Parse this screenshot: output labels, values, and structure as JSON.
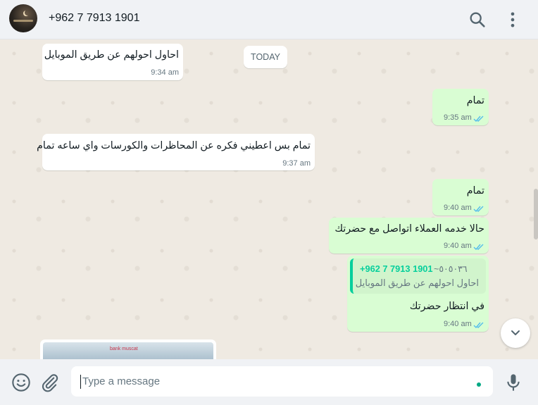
{
  "header": {
    "contact_name": "+962 7 7913 1901",
    "search_icon": "search-icon",
    "menu_icon": "kebab-menu-icon"
  },
  "chat": {
    "date_divider": "TODAY",
    "messages": [
      {
        "direction": "incoming",
        "text": "احاول احولهم عن طريق الموبايل",
        "time": "9:34 am"
      },
      {
        "direction": "outgoing",
        "text": "تمام",
        "time": "9:35 am",
        "status": "read"
      },
      {
        "direction": "incoming",
        "text": "تمام بس اعطيني فكره عن المحاظرات والكورسات واي ساعه تمام",
        "time": "9:37 am"
      },
      {
        "direction": "outgoing",
        "text": "تمام",
        "time": "9:40 am",
        "status": "read"
      },
      {
        "direction": "outgoing",
        "text": "حالا خدمه العملاء اتواصل مع حضرتك",
        "time": "9:40 am",
        "status": "read"
      },
      {
        "direction": "outgoing",
        "text": "في انتظار حضرتك",
        "time": "9:40 am",
        "status": "read",
        "quoted": {
          "sender": "+962 7 7913 1901",
          "sender_alt": "~٥٠٥٠٣٦",
          "text": "احاول احولهم عن طريق الموبايل"
        }
      }
    ],
    "image_preview_caption": "bank muscat"
  },
  "composer": {
    "placeholder": "Type a message",
    "value": ""
  },
  "colors": {
    "outgoing_bubble": "#d9fdd3",
    "incoming_bubble": "#ffffff",
    "accent": "#00a884",
    "read_tick": "#53bdeb"
  }
}
